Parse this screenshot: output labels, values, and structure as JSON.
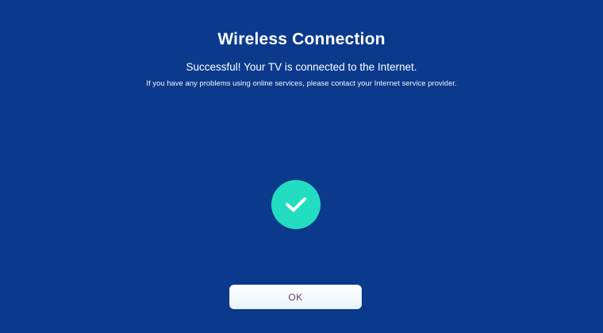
{
  "dialog": {
    "title": "Wireless Connection",
    "message": "Successful! Your TV is connected to the Internet.",
    "note": "If you have any problems using online services, please contact your Internet service provider.",
    "status_icon": "checkmark-icon",
    "ok_label": "OK"
  },
  "colors": {
    "background": "#0b3a8c",
    "success": "#23ddc0",
    "button_text": "#6a3d69"
  }
}
